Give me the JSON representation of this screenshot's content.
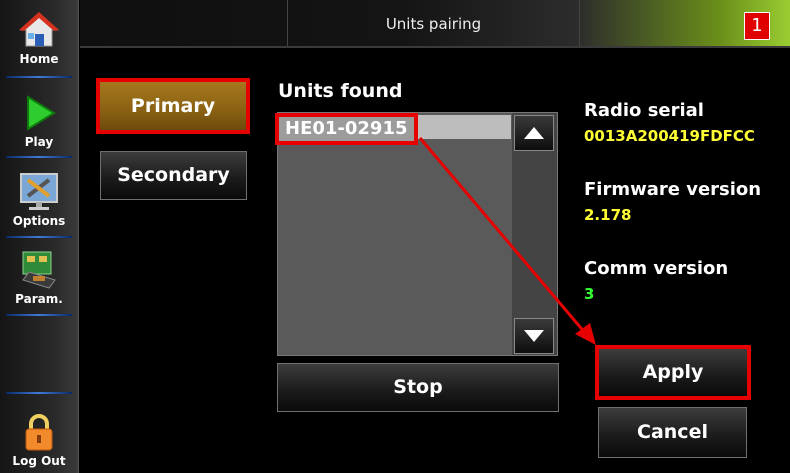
{
  "sidebar": {
    "items": [
      {
        "label": "Home",
        "icon": "home-icon"
      },
      {
        "label": "Play",
        "icon": "play-icon"
      },
      {
        "label": "Options",
        "icon": "options-icon"
      },
      {
        "label": "Param.",
        "icon": "parameters-icon"
      },
      {
        "label": "Log Out",
        "icon": "lock-icon"
      }
    ]
  },
  "header": {
    "title": "Units pairing",
    "badge": "1"
  },
  "buttons": {
    "primary": "Primary",
    "secondary": "Secondary",
    "stop": "Stop",
    "apply": "Apply",
    "cancel": "Cancel"
  },
  "units": {
    "heading": "Units found",
    "items": [
      "HE01-02915"
    ]
  },
  "info": {
    "radio_serial_label": "Radio serial",
    "radio_serial_value": "0013A200419FDFCC",
    "firmware_label": "Firmware version",
    "firmware_value": "2.178",
    "comm_label": "Comm version",
    "comm_value": "3"
  },
  "colors": {
    "highlight_red": "#e60000",
    "value_yellow": "#ffff33",
    "value_green": "#33ff33",
    "primary_gold": "#8a6113"
  }
}
